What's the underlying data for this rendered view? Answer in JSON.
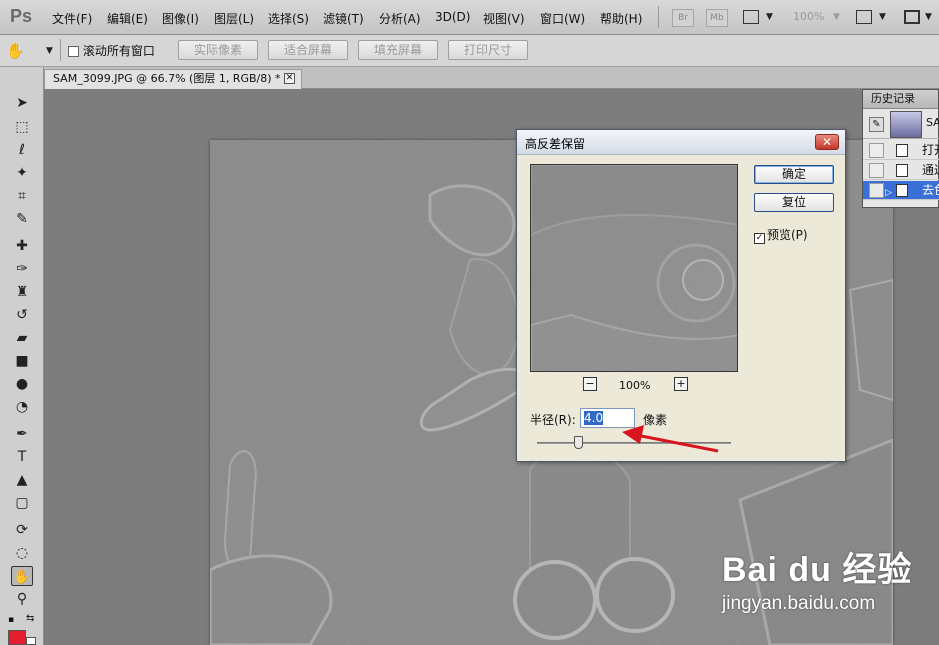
{
  "app": {
    "logo": "Ps",
    "menu": [
      "文件(F)",
      "编辑(E)",
      "图像(I)",
      "图层(L)",
      "选择(S)",
      "滤镜(T)",
      "分析(A)",
      "3D(D)",
      "视图(V)",
      "窗口(W)",
      "帮助(H)"
    ],
    "bridge_btn": "Br",
    "minibridge_btn": "Mb",
    "zoom_level": "100%"
  },
  "options_bar": {
    "scroll_all": "滚动所有窗口",
    "actual_pixels": "实际像素",
    "fit_screen": "适合屏幕",
    "fill_screen": "填充屏幕",
    "print_size": "打印尺寸"
  },
  "document": {
    "tab_title": "SAM_3099.JPG @ 66.7% (图层 1, RGB/8) *",
    "close": "✕"
  },
  "history": {
    "title": "历史记录",
    "snapshot_label": "SA",
    "items": [
      {
        "label": "打开",
        "active": false
      },
      {
        "label": "通过",
        "active": false
      },
      {
        "label": "去色",
        "active": true
      }
    ]
  },
  "dialog": {
    "title": "高反差保留",
    "ok": "确定",
    "reset": "复位",
    "preview_label": "预览(P)",
    "preview_checked": "✓",
    "zoom_out": "−",
    "zoom_in": "+",
    "zoom_level": "100%",
    "radius_label": "半径(R):",
    "radius_value": "4.0",
    "radius_unit": "像素",
    "close": "✕"
  },
  "watermark": {
    "main": "Bai du 经验",
    "url": "jingyan.baidu.com"
  },
  "colors": {
    "foreground": "#e41e2f",
    "background": "#ffffff",
    "history_highlight": "#3a6fd8",
    "annotation_arrow": "#d8141e"
  }
}
